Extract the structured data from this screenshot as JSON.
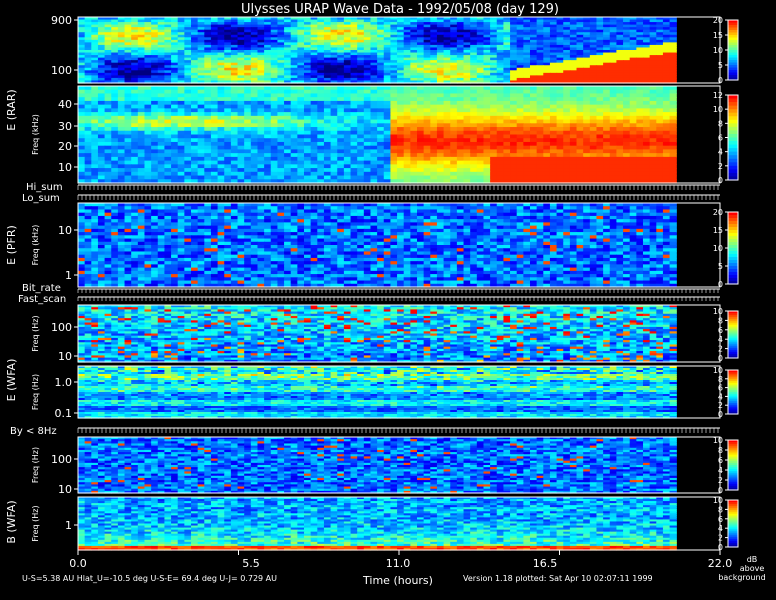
{
  "title": "Ulysses URAP Wave Data - 1992/05/08  (day 129)",
  "xlabel": "Time (hours)",
  "x_ticks": [
    "0.0",
    "5.5",
    "11.0",
    "16.5",
    "22.0"
  ],
  "footer": {
    "left": "U-S=5.38 AU  Hlat_U=-10.5 deg   U-S-E= 69.4 deg  U-J= 0.729 AU",
    "right": "Version 1.18 plotted: Sat Apr 10 02:07:11 1999",
    "unit_line1": "dB",
    "unit_line2": "above",
    "unit_line3": "background"
  },
  "colormap": [
    "#000080",
    "#0000ff",
    "#0080ff",
    "#00ffff",
    "#80ff80",
    "#ffff00",
    "#ff8000",
    "#ff0000"
  ],
  "group_labels": {
    "rar": "E (RAR)",
    "pfr": "E (PFR)",
    "wfa_e": "E (WFA)",
    "wfa_b": "B (WFA)"
  },
  "status_labels": {
    "hi_sum": "Hi_sum",
    "lo_sum": "Lo_sum",
    "bit_rate": "Bit_rate",
    "fast_scan": "Fast_scan",
    "by_8hz": "By < 8Hz"
  },
  "chart_data": {
    "type": "heatmap",
    "title": "Ulysses URAP Wave Data - 1992/05/08  (day 129)",
    "xlabel": "Time (hours)",
    "xlim": [
      0.0,
      22.0
    ],
    "data_end_hours": 20.5,
    "panels": [
      {
        "id": "rar_high",
        "ylabel": "",
        "y_ticks": [
          "900",
          "100"
        ],
        "colorbar_ticks": [
          "20",
          "15",
          "10",
          "5",
          "0"
        ],
        "colorbar_max": 20,
        "feature": "type_iii_burst",
        "burst_start_hours": 14.6
      },
      {
        "id": "rar_low",
        "ylabel": "Freq (kHz)",
        "y_ticks": [
          "40",
          "30",
          "20",
          "10"
        ],
        "colorbar_ticks": [
          "12",
          "10",
          "8",
          "6",
          "4",
          "2",
          "0"
        ],
        "colorbar_max": 12,
        "feature": "emission_band",
        "burst_start_hours": 10.5
      },
      {
        "id": "pfr",
        "ylabel": "Freq (kHz)",
        "y_ticks": [
          "10",
          "1"
        ],
        "colorbar_ticks": [
          "20",
          "15",
          "10",
          "5",
          "0"
        ],
        "colorbar_max": 20,
        "feature": "noise"
      },
      {
        "id": "wfa_e_high",
        "ylabel": "Freq (Hz)",
        "y_ticks": [
          "100",
          "10"
        ],
        "colorbar_ticks": [
          "10",
          "8",
          "6",
          "4",
          "2",
          "0"
        ],
        "colorbar_max": 10,
        "feature": "bursty"
      },
      {
        "id": "wfa_e_low",
        "ylabel": "Freq (Hz)",
        "y_ticks": [
          "1.0",
          "0.1"
        ],
        "colorbar_ticks": [
          "10",
          "8",
          "6",
          "4",
          "2",
          "0"
        ],
        "colorbar_max": 10,
        "feature": "banded"
      },
      {
        "id": "wfa_b_high",
        "ylabel": "Freq (Hz)",
        "y_ticks": [
          "100",
          "10"
        ],
        "colorbar_ticks": [
          "10",
          "8",
          "6",
          "4",
          "2",
          "0"
        ],
        "colorbar_max": 10,
        "feature": "noise"
      },
      {
        "id": "wfa_b_low",
        "ylabel": "Freq (Hz)",
        "y_ticks": [
          "1"
        ],
        "colorbar_ticks": [
          "10",
          "8",
          "6",
          "4",
          "2",
          "0"
        ],
        "colorbar_max": 10,
        "feature": "banded_bottom"
      }
    ]
  }
}
